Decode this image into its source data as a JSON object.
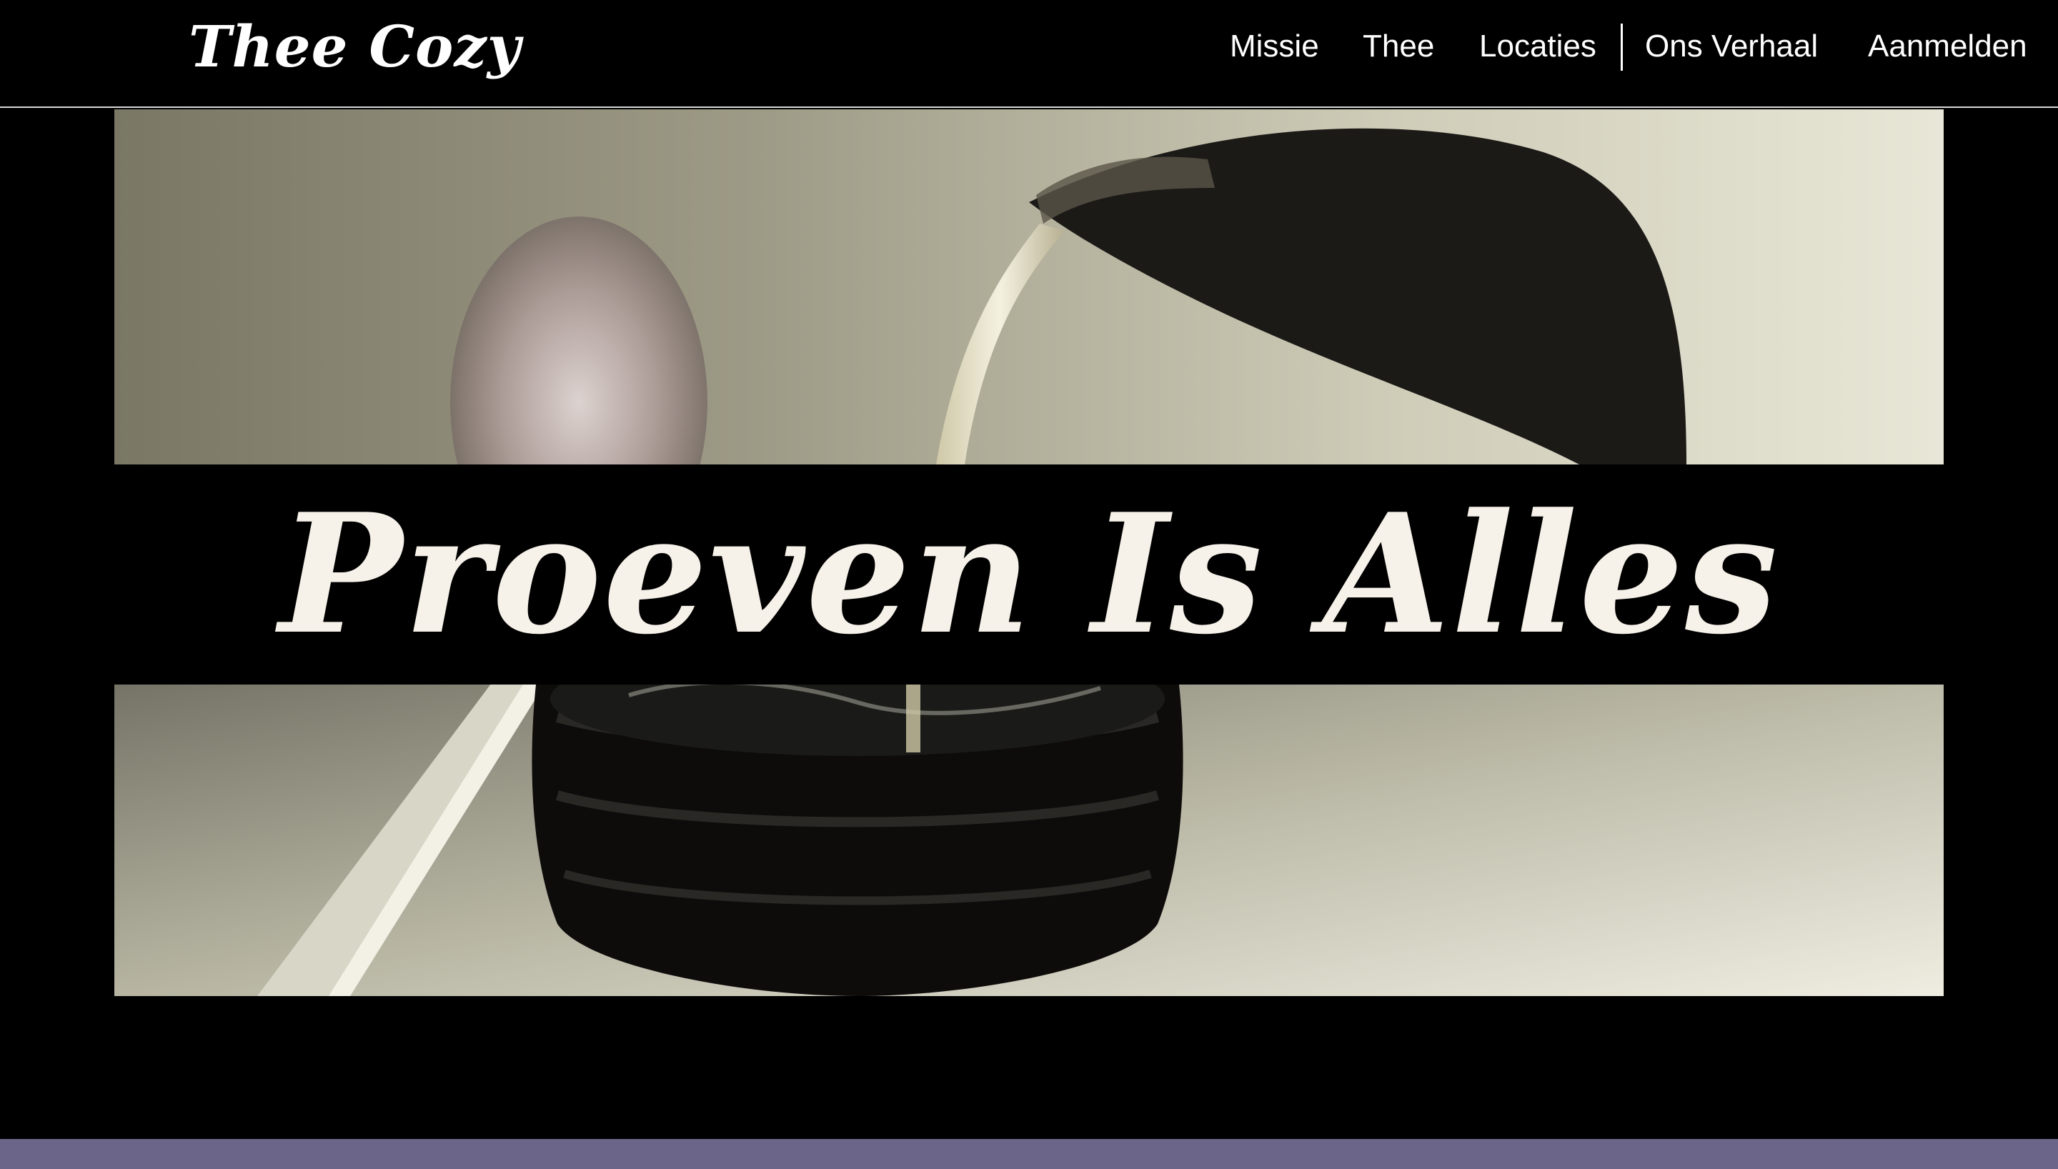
{
  "header": {
    "logo": "Thee Cozy",
    "nav": [
      {
        "label": "Missie"
      },
      {
        "label": "Thee"
      },
      {
        "label": "Locaties"
      },
      {
        "label": "Ons Verhaal"
      },
      {
        "label": "Aanmelden"
      }
    ]
  },
  "hero": {
    "heading": "Proeven Is Alles"
  },
  "colors": {
    "background": "#000000",
    "text": "#ffffff",
    "heading": "#f6f1e9",
    "bottom_band": "#6b6689"
  }
}
